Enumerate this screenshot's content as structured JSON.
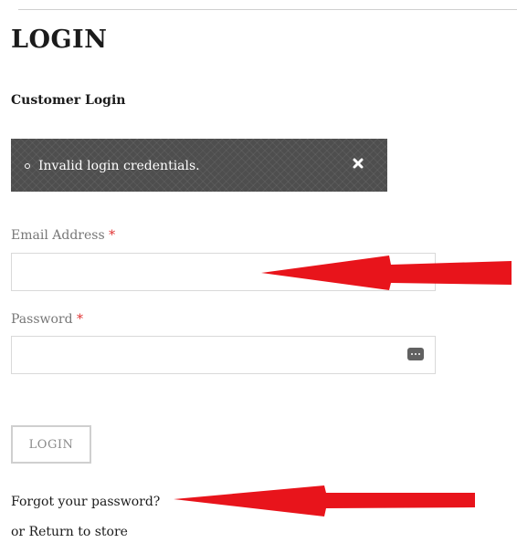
{
  "page": {
    "title": "LOGIN",
    "subtitle": "Customer Login"
  },
  "alert": {
    "message": "Invalid login credentials.",
    "close_icon": "close-icon"
  },
  "form": {
    "email_label": "Email Address",
    "password_label": "Password",
    "required_marker": "*",
    "email_value": "",
    "password_value": "",
    "password_manager_icon": "password-manager-icon",
    "submit_label": "LOGIN"
  },
  "links": {
    "forgot_password": "Forgot your password?",
    "or_prefix": "or",
    "return_to_store": "Return to store"
  },
  "annotations": {
    "arrow_color": "#e8141b",
    "arrow_icon": "left-arrow-annotation"
  },
  "colors": {
    "error_bg": "#4e4e4e",
    "label_text": "#777777",
    "required": "#e03131"
  }
}
